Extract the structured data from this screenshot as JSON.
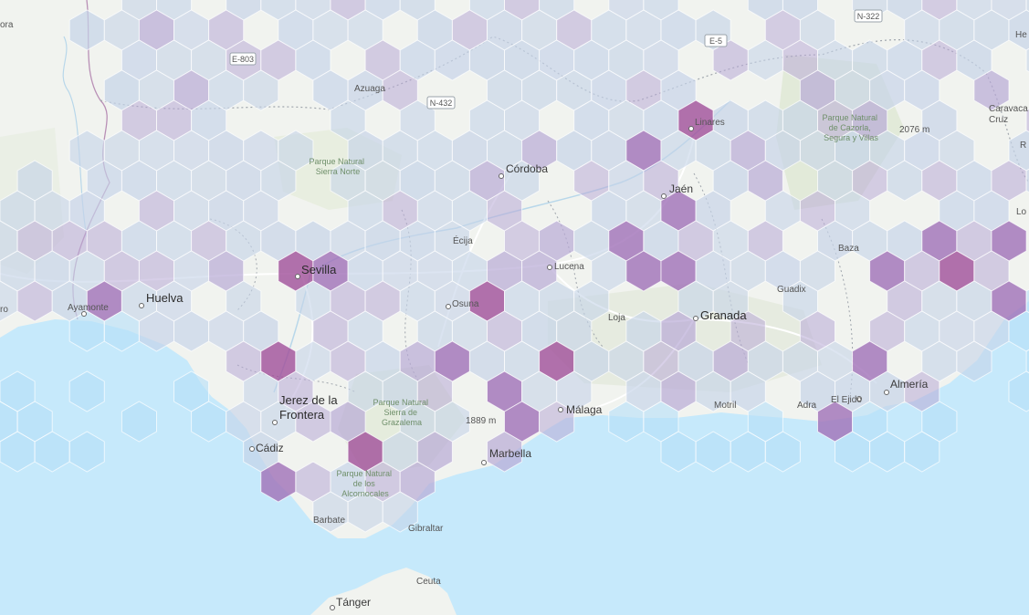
{
  "map": {
    "colors": {
      "sea": "#c6e9fb",
      "land": "#f1f3ef",
      "hex_low": "#c5d3e8",
      "hex_mid": "#b8aad6",
      "hex_high": "#a070b8",
      "hex_top": "#a04f9a",
      "hex_sea": "#b5dff8"
    },
    "cities": [
      {
        "name": "Sevilla",
        "size": "lg"
      },
      {
        "name": "Huelva",
        "size": "md"
      },
      {
        "name": "Ayamonte",
        "size": "sm"
      },
      {
        "name": "Córdoba",
        "size": "md"
      },
      {
        "name": "Jaén",
        "size": "md"
      },
      {
        "name": "Linares",
        "size": "sm"
      },
      {
        "name": "Granada",
        "size": "lg"
      },
      {
        "name": "Málaga",
        "size": "md"
      },
      {
        "name": "Marbella",
        "size": "md"
      },
      {
        "name": "Almería",
        "size": "md"
      },
      {
        "name": "El Ejido",
        "size": "sm"
      },
      {
        "name": "Adra",
        "size": "sm"
      },
      {
        "name": "Motril",
        "size": "sm"
      },
      {
        "name": "Cádiz",
        "size": "md"
      },
      {
        "name": "Jerez de la",
        "size": "lg"
      },
      {
        "name": "Frontera",
        "size": "lg"
      },
      {
        "name": "Écija",
        "size": "sm"
      },
      {
        "name": "Osuna",
        "size": "sm"
      },
      {
        "name": "Lucena",
        "size": "sm"
      },
      {
        "name": "Loja",
        "size": "sm"
      },
      {
        "name": "Guadix",
        "size": "sm"
      },
      {
        "name": "Baza",
        "size": "sm"
      },
      {
        "name": "Azuaga",
        "size": "sm"
      },
      {
        "name": "Barbate",
        "size": "sm"
      },
      {
        "name": "Gibraltar",
        "size": "sm"
      },
      {
        "name": "Ceuta",
        "size": "sm"
      },
      {
        "name": "Tánger",
        "size": "md"
      },
      {
        "name": "Caravaca",
        "size": "sm"
      },
      {
        "name": "Cruz",
        "size": "sm"
      },
      {
        "name": "ora",
        "size": "sm"
      },
      {
        "name": "ro",
        "size": "sm"
      },
      {
        "name": "Lo",
        "size": "sm"
      },
      {
        "name": "R",
        "size": "sm"
      },
      {
        "name": "He",
        "size": "sm"
      }
    ],
    "parks": [
      {
        "lines": [
          "Parque Natural",
          "Sierra Norte"
        ]
      },
      {
        "lines": [
          "Parque Natural",
          "de Cazorla,",
          "Segura y Villas"
        ]
      },
      {
        "lines": [
          "Parque Natural",
          "Sierra de",
          "Grazalema"
        ]
      },
      {
        "lines": [
          "Parque Natural",
          "de los",
          "Alcornocales"
        ]
      }
    ],
    "peaks": [
      "2076 m",
      "1889 m"
    ],
    "roads": [
      "E-803",
      "N-432",
      "E-5",
      "N-322"
    ]
  }
}
